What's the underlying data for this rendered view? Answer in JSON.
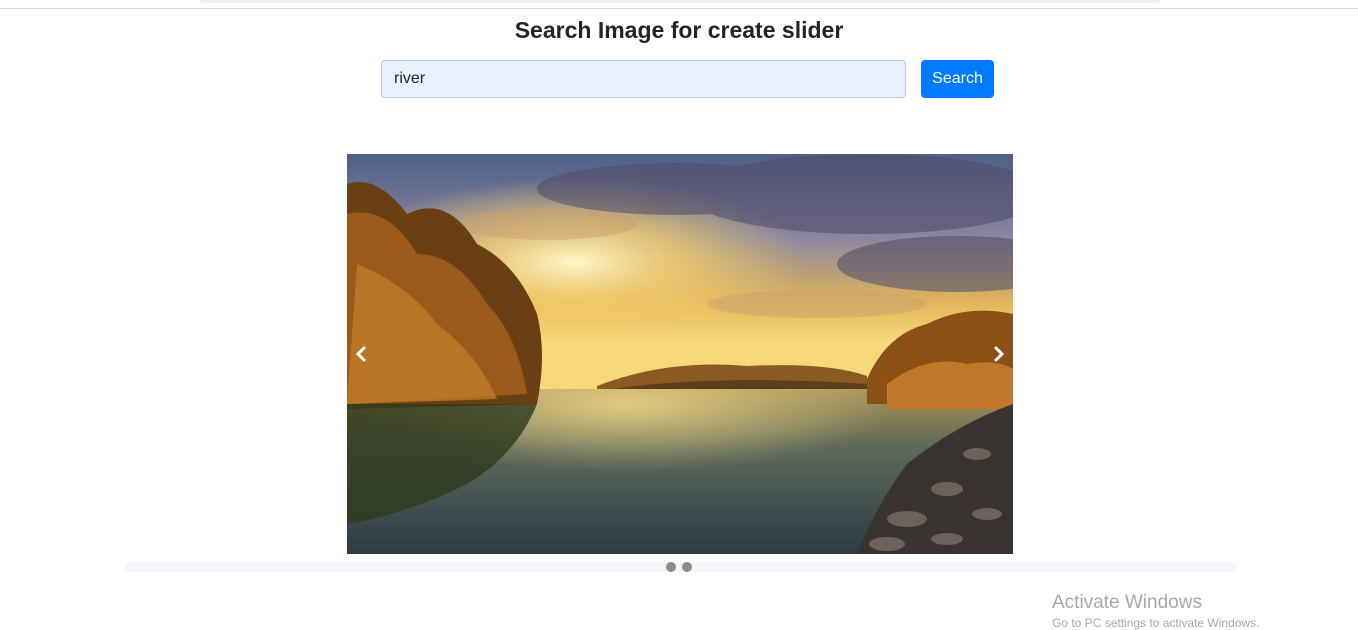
{
  "page": {
    "title": "Search Image for create slider"
  },
  "search": {
    "value": "river",
    "button_label": "Search"
  },
  "slider": {
    "current_slide": 1,
    "slide_count": 2,
    "slide_subject": "river at sunset with autumn trees",
    "prev_icon": "chevron-left-icon",
    "next_icon": "chevron-right-icon"
  },
  "watermark": {
    "title": "Activate Windows",
    "subtitle": "Go to PC settings to activate Windows."
  },
  "colors": {
    "accent": "#007bff",
    "input_bg": "#e8f0fe",
    "dot": "#8a8a8a"
  }
}
